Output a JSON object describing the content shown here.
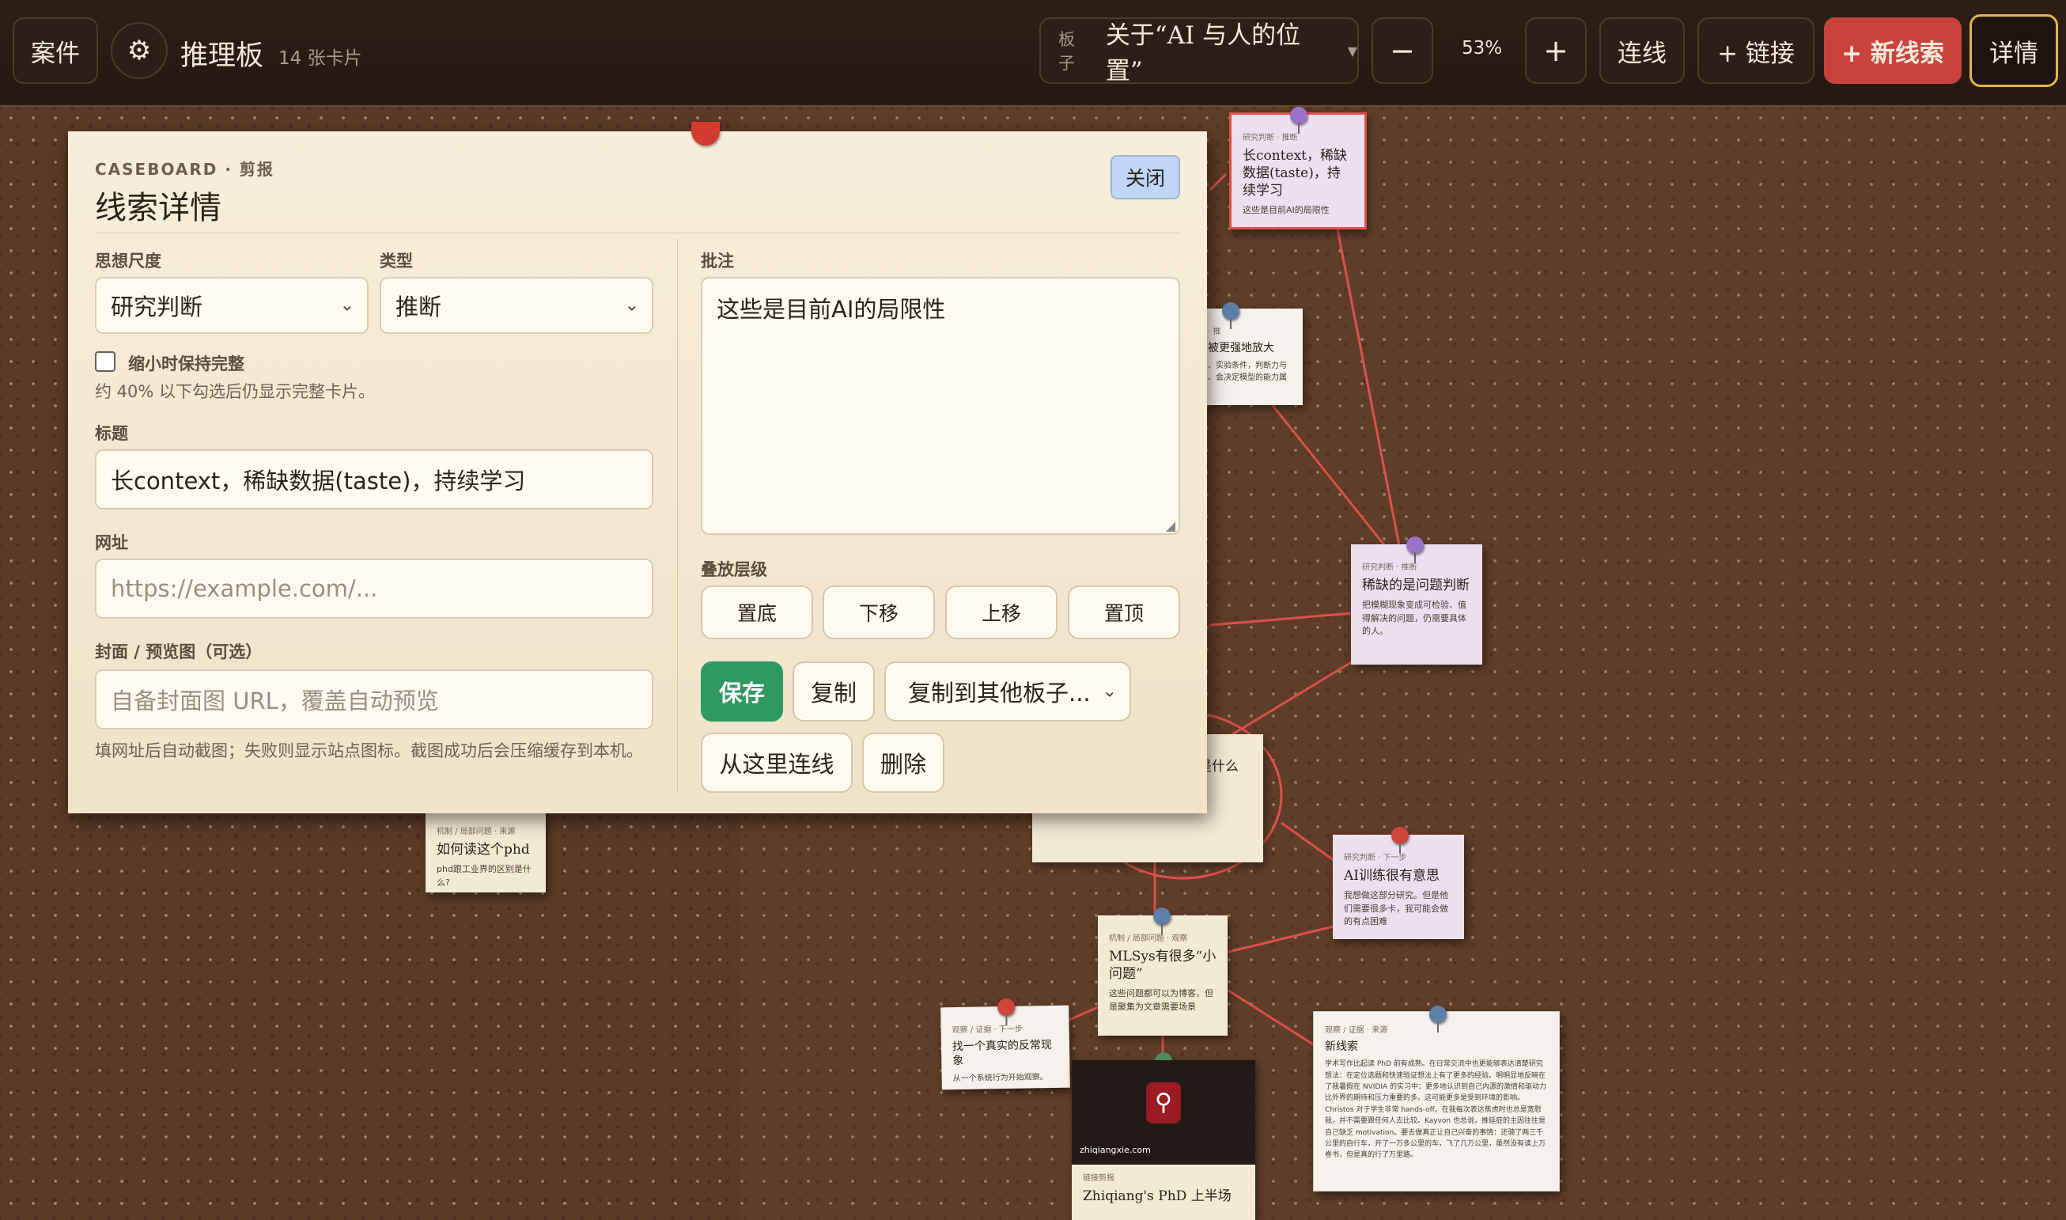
{
  "toolbar": {
    "cases_label": "案件",
    "board_title": "推理板",
    "card_count": "14 张卡片",
    "board_prefix": "板子",
    "board_name": "关于“AI 与人的位置”",
    "zoom_out": "−",
    "zoom_level": "53%",
    "zoom_in": "+",
    "connect_label": "连线",
    "add_link_label": "+ 链接",
    "new_clue_label": "+ 新线索",
    "details_label": "详情"
  },
  "panel": {
    "eyebrow": "CASEBOARD · 剪报",
    "title": "线索详情",
    "close_label": "关闭",
    "scale_label": "思想尺度",
    "scale_value": "研究判断",
    "type_label": "类型",
    "type_value": "推断",
    "keep_full_label": "缩小时保持完整",
    "keep_full_hint": "约 40% 以下勾选后仍显示完整卡片。",
    "title_label": "标题",
    "title_value": "长context，稀缺数据(taste)，持续学习",
    "url_label": "网址",
    "url_placeholder": "https://example.com/...",
    "cover_label": "封面 / 预览图（可选）",
    "cover_placeholder": "自备封面图 URL，覆盖自动预览",
    "cover_hint": "填网址后自动截图；失败则显示站点图标。截图成功后会压缩缓存到本机。",
    "note_label": "批注",
    "note_value": "这些是目前AI的局限性",
    "layer_label": "叠放层级",
    "layer_bottom": "置底",
    "layer_down": "下移",
    "layer_up": "上移",
    "layer_top": "置顶",
    "save_label": "保存",
    "copy_label": "复制",
    "copy_to_label": "复制到其他板子...",
    "connect_from_label": "从这里连线",
    "delete_label": "删除"
  },
  "cards": {
    "c1": {
      "kind": "研究判断 · 推断",
      "title": "长context，稀缺数据(taste)，持续学习",
      "desc": "这些是目前AI的局限性"
    },
    "c2": {
      "kind": "· 推",
      "title": "被更强地放大",
      "desc": "、实验条件，判断力与 、会决定模型的能力属"
    },
    "c3": {
      "kind": "研究判断 · 推断",
      "title": "稀缺的是问题判断",
      "desc": "把模糊现象变成可检验、值得解决的问题，仍需要具体的人。"
    },
    "c4": {
      "title": "是什么"
    },
    "c5": {
      "kind": "研究判断 · 下一步",
      "title": "AI训练很有意思",
      "desc": "我想做这部分研究。但是他们需要很多卡，我可能会做的有点困难"
    },
    "c6": {
      "kind": "机制 / 局部问题 · 观察",
      "title": "MLSys有很多“小问题”",
      "desc": "这些问题都可以为博客，但是聚集为文章需要场景"
    },
    "c7": {
      "kind": "观察 / 证据 · 下一步",
      "title": "找一个真实的反常现象",
      "desc": "从一个系统行为开始观察。"
    },
    "c8": {
      "kind": "机制 / 局部问题 · 来源",
      "title": "如何读这个phd",
      "desc": "phd跟工业界的区别是什么?"
    },
    "c9": {
      "kind": "观察 / 证据 · 来源",
      "title": "新线索",
      "desc": "学术写作比起读 PhD 前有成熟。在日常交流中也更能够表达清楚研究想法：在定位选题和快速验证想法上有了更多的经验。明明显地反映在了我暑假在 NVIDIA 的实习中：更多地认识到自己内源的激情和驱动力比外界的期待和压力重要的多。这可能更多是受到环境的影响。Christos 对于学生非常 hands-off。在我每次表达焦虑时也总是宽慰我，并不需要跟任何人去比较。Kayvon 也总说，推延症的主因往往是自己缺乏 motivation。要去做真正让自己兴奋的事情：还骑了两三千公里的自行车，开了一万多公里的车，飞了几万公里，虽然没有读上万卷书，但是真的行了万里路。"
    },
    "c10": {
      "site": "zhiqiangxie.com",
      "kind": "链接剪报",
      "title": "Zhiqiang's PhD 上半场"
    }
  }
}
